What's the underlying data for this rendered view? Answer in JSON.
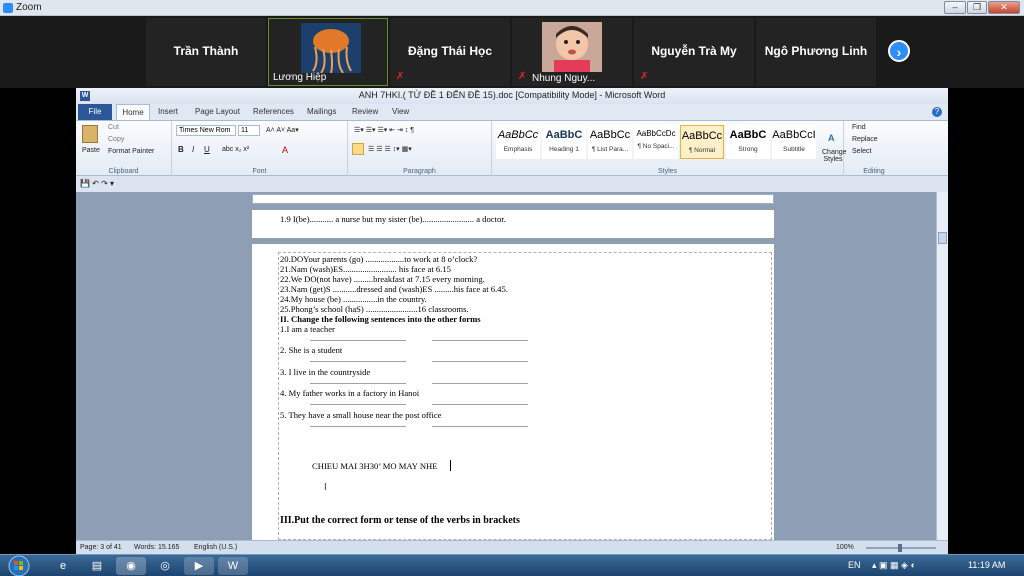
{
  "zoom": {
    "title": "Zoom"
  },
  "participants": [
    {
      "name": "Trần Thành",
      "muted": false
    },
    {
      "name": "Lương Hiệp",
      "muted": false
    },
    {
      "name": "Đặng Thái Học",
      "muted": true
    },
    {
      "name": "Nhung Nguy...",
      "muted": true
    },
    {
      "name": "Nguyễn Trà My",
      "muted": true
    },
    {
      "name": "Ngô Phương Linh",
      "muted": false
    }
  ],
  "word": {
    "title": "ANH 7HKI.( TỪ ĐỀ 1 ĐẾN ĐỀ 15).doc [Compatibility Mode] - Microsoft Word",
    "tabs": [
      "File",
      "Home",
      "Insert",
      "Page Layout",
      "References",
      "Mailings",
      "Review",
      "View"
    ],
    "clipboard": {
      "paste": "Paste",
      "cut": "Cut",
      "copy": "Copy",
      "format_painter": "Format Painter",
      "label": "Clipboard"
    },
    "font": {
      "name": "Times New Rom",
      "size": "11",
      "label": "Font"
    },
    "paragraph": {
      "label": "Paragraph"
    },
    "styles": {
      "label": "Styles",
      "items": [
        {
          "sample": "AaBbCc",
          "name": "Emphasis"
        },
        {
          "sample": "AaBbC",
          "name": "Heading 1"
        },
        {
          "sample": "AaBbCc",
          "name": "¶ List Para..."
        },
        {
          "sample": "AaBbCcDc",
          "name": "¶ No Spaci..."
        },
        {
          "sample": "AaBbCc",
          "name": "¶ Normal"
        },
        {
          "sample": "AaBbC",
          "name": "Strong"
        },
        {
          "sample": "AaBbCcI",
          "name": "Subtitle"
        }
      ],
      "change_styles": "Change Styles"
    },
    "editing": {
      "find": "Find",
      "replace": "Replace",
      "select": "Select",
      "label": "Editing"
    },
    "doc_lines_top": [
      "1.9 I(be)........... a nurse but my sister (be)........................ a doctor."
    ],
    "doc_lines": [
      "20.DOYour parents (go) ..................to work at 8 o’clock?",
      "21.Nam (wash)ES......................... his face at 6.15",
      "22.We DO(not have) .........breakfast at 7.15 every morning.",
      "23.Nam (get)S ...........dressed and (wash)ES .........his face at 6.45.",
      "24.My house (be) ................in the country.",
      "25.Phong’s school (haS) ........................16 classrooms."
    ],
    "section2_heading": "II. Change the following sentences into the other forms",
    "section2_items": [
      "1.I am a teacher",
      "2. She is a student",
      "3. I live in the countryside",
      "4. My father works in a factory in Hanoi",
      "5. They have a small house near the post office"
    ],
    "blank_dots": "................................................",
    "note": "CHIEU MAI 3H30’ MO MAY NHE",
    "section3_heading": "III.Put the  correct  form or tense of the verbs in brackets",
    "status": {
      "page": "Page: 3 of 41",
      "words": "Words: 15.165",
      "language": "English (U.S.)",
      "zoom": "100%"
    }
  },
  "taskbar": {
    "lang": "EN",
    "time": "11:19 AM"
  }
}
